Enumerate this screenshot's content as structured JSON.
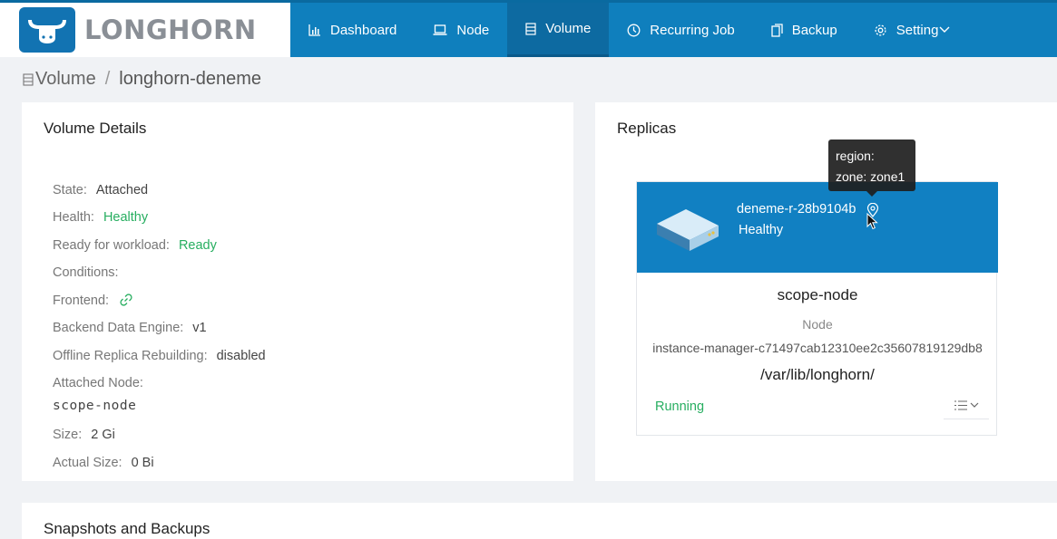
{
  "app": {
    "logo_text": "LONGHORN"
  },
  "nav": [
    {
      "label": "Dashboard",
      "icon": "bar-chart-icon",
      "active": false
    },
    {
      "label": "Node",
      "icon": "laptop-icon",
      "active": false
    },
    {
      "label": "Volume",
      "icon": "database-icon",
      "active": true
    },
    {
      "label": "Recurring Job",
      "icon": "clock-icon",
      "active": false
    },
    {
      "label": "Backup",
      "icon": "copy-icon",
      "active": false
    },
    {
      "label": "Setting",
      "icon": "gear-icon",
      "active": false
    }
  ],
  "breadcrumb": {
    "root": "Volume",
    "separator": "/",
    "current": "longhorn-deneme"
  },
  "details": {
    "title": "Volume Details",
    "state_label": "State:",
    "state_value": "Attached",
    "health_label": "Health:",
    "health_value": "Healthy",
    "ready_label": "Ready for workload:",
    "ready_value": "Ready",
    "conditions_label": "Conditions:",
    "frontend_label": "Frontend:",
    "backend_label": "Backend Data Engine:",
    "backend_value": "v1",
    "offline_label": "Offline Replica Rebuilding:",
    "offline_value": "disabled",
    "attached_label": "Attached Node:",
    "attached_value": "scope-node",
    "size_label": "Size:",
    "size_value": "2 Gi",
    "actual_label": "Actual Size:",
    "actual_value": "0 Bi"
  },
  "replicas": {
    "title": "Replicas",
    "name": "deneme-r-28b9104b",
    "health": "Healthy",
    "node": "scope-node",
    "node_label": "Node",
    "instance_manager": "instance-manager-c71497cab12310ee2c35607819129db8",
    "path": "/var/lib/longhorn/",
    "status": "Running"
  },
  "tooltip": {
    "region": "region:",
    "zone": "zone: zone1"
  },
  "snapshots": {
    "title": "Snapshots and Backups"
  },
  "colors": {
    "primary": "#0f7fbd",
    "active_nav": "#0d6aa1",
    "success": "#27ae60"
  }
}
